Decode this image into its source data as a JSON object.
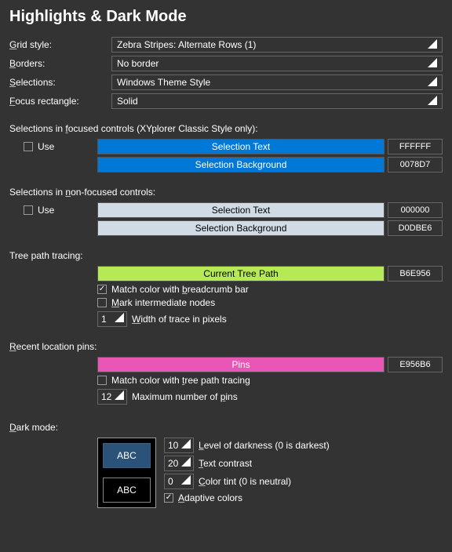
{
  "title": "Highlights & Dark Mode",
  "combos": {
    "grid_style": {
      "label": "Grid style:",
      "value": "Zebra Stripes: Alternate Rows (1)",
      "u": "G"
    },
    "borders": {
      "label": "Borders:",
      "value": "No border",
      "u": "B"
    },
    "selections": {
      "label": "Selections:",
      "value": "Windows Theme Style",
      "u": "S"
    },
    "focus_rect": {
      "label": "Focus rectangle:",
      "value": "Solid",
      "u": "F"
    }
  },
  "focused": {
    "heading": "Selections in focused controls (XYplorer Classic Style only):",
    "heading_u": "f",
    "use": "Use",
    "text_label": "Selection Text",
    "text_hex": "FFFFFF",
    "text_bg": "#0078D7",
    "bg_label": "Selection Background",
    "bg_hex": "0078D7",
    "bg_bg": "#0078D7"
  },
  "nonfocused": {
    "heading": "Selections in non-focused controls:",
    "heading_u": "n",
    "use": "Use",
    "text_label": "Selection Text",
    "text_hex": "000000",
    "text_bg": "#D0DBE6",
    "bg_label": "Selection Background",
    "bg_hex": "D0DBE6",
    "bg_bg": "#D0DBE6"
  },
  "tree": {
    "heading": "Tree path tracing:",
    "btn_label": "Current Tree Path",
    "btn_bg": "#B6E956",
    "btn_hex": "B6E956",
    "match_label": "Match color with breadcrumb bar",
    "match_u": "b",
    "mark_label": "Mark intermediate nodes",
    "mark_u": "M",
    "width_val": "1",
    "width_label": "Width of trace in pixels",
    "width_u": "W"
  },
  "pins": {
    "heading": "Recent location pins:",
    "heading_u": "R",
    "btn_label": "Pins",
    "btn_bg": "#E956B6",
    "btn_hex": "E956B6",
    "match_label": "Match color with tree path tracing",
    "match_u": "t",
    "max_val": "12",
    "max_label": "Maximum number of pins",
    "max_u": "p"
  },
  "dark": {
    "heading": "Dark mode:",
    "heading_u": "D",
    "swatch1_bg": "#2b5278",
    "swatch1_txt": "ABC",
    "swatch2_bg": "#000000",
    "swatch2_txt": "ABC",
    "level_val": "10",
    "level_label": "Level of darkness (0 is darkest)",
    "level_u": "L",
    "contrast_val": "20",
    "contrast_label": "Text contrast",
    "contrast_u": "T",
    "tint_val": "0",
    "tint_label": "Color tint (0 is neutral)",
    "tint_u": "C",
    "adaptive_label": "Adaptive colors",
    "adaptive_u": "A"
  }
}
